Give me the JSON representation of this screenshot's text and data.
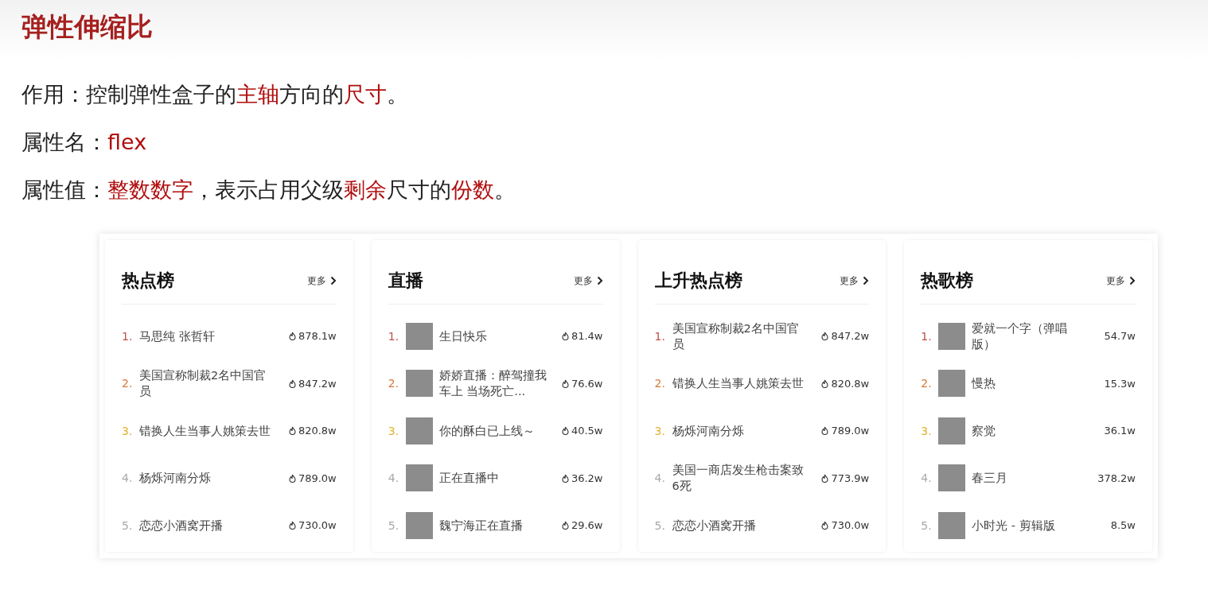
{
  "title": "弹性伸缩比",
  "lines": [
    {
      "segments": [
        {
          "text": "作用：控制弹性盒子的",
          "highlight": false
        },
        {
          "text": "主轴",
          "highlight": true
        },
        {
          "text": "方向的",
          "highlight": false
        },
        {
          "text": "尺寸",
          "highlight": true
        },
        {
          "text": "。",
          "highlight": false
        }
      ]
    },
    {
      "segments": [
        {
          "text": "属性名：",
          "highlight": false
        },
        {
          "text": "flex",
          "highlight": true
        }
      ]
    },
    {
      "segments": [
        {
          "text": "属性值：",
          "highlight": false
        },
        {
          "text": "整数数字",
          "highlight": true
        },
        {
          "text": "，表示占用父级",
          "highlight": false
        },
        {
          "text": "剩余",
          "highlight": true
        },
        {
          "text": "尺寸的",
          "highlight": false
        },
        {
          "text": "份数",
          "highlight": true
        },
        {
          "text": "。",
          "highlight": false
        }
      ]
    }
  ],
  "cards": [
    {
      "title": "热点榜",
      "more": "更多",
      "show_flame": true,
      "items": [
        {
          "rank": "1.",
          "color": "#c0504d",
          "kind": "plain",
          "text": "马思纯 张哲轩",
          "count": "878.1w"
        },
        {
          "rank": "2.",
          "color": "#d9773a",
          "kind": "plain",
          "text": "美国宣称制裁2名中国官员",
          "count": "847.2w"
        },
        {
          "rank": "3.",
          "color": "#e0b12a",
          "kind": "plain",
          "text": "错换人生当事人姚策去世",
          "count": "820.8w"
        },
        {
          "rank": "4.",
          "color": "#a8a8a8",
          "kind": "plain",
          "text": "杨烁河南分烁",
          "count": "789.0w"
        },
        {
          "rank": "5.",
          "color": "#a8a8a8",
          "kind": "plain",
          "text": "恋恋小酒窝开播",
          "count": "730.0w"
        }
      ]
    },
    {
      "title": "直播",
      "more": "更多",
      "show_flame": true,
      "items": [
        {
          "rank": "1.",
          "color": "#c0504d",
          "kind": "thumb",
          "text": "生日快乐",
          "count": "81.4w"
        },
        {
          "rank": "2.",
          "color": "#d9773a",
          "kind": "thumb",
          "text": "娇娇直播：醉驾撞我车上 当场死亡...",
          "count": "76.6w"
        },
        {
          "rank": "3.",
          "color": "#e0b12a",
          "kind": "thumb",
          "text": "你的酥白已上线～",
          "count": "40.5w"
        },
        {
          "rank": "4.",
          "color": "#a8a8a8",
          "kind": "thumb",
          "text": "正在直播中",
          "count": "36.2w"
        },
        {
          "rank": "5.",
          "color": "#a8a8a8",
          "kind": "thumb",
          "text": "魏宁海正在直播",
          "count": "29.6w"
        }
      ]
    },
    {
      "title": "上升热点榜",
      "more": "更多",
      "show_flame": true,
      "items": [
        {
          "rank": "1.",
          "color": "#c0504d",
          "kind": "plain",
          "text": "美国宣称制裁2名中国官员",
          "count": "847.2w"
        },
        {
          "rank": "2.",
          "color": "#d9773a",
          "kind": "plain",
          "text": "错换人生当事人姚策去世",
          "count": "820.8w"
        },
        {
          "rank": "3.",
          "color": "#e0b12a",
          "kind": "plain",
          "text": "杨烁河南分烁",
          "count": "789.0w"
        },
        {
          "rank": "4.",
          "color": "#a8a8a8",
          "kind": "plain",
          "text": "美国一商店发生枪击案致6死",
          "count": "773.9w"
        },
        {
          "rank": "5.",
          "color": "#a8a8a8",
          "kind": "plain",
          "text": "恋恋小酒窝开播",
          "count": "730.0w"
        }
      ]
    },
    {
      "title": "热歌榜",
      "more": "更多",
      "show_flame": false,
      "items": [
        {
          "rank": "1.",
          "color": "#c0504d",
          "kind": "thumb",
          "text": "爱就一个字（弹唱版）",
          "count": "54.7w"
        },
        {
          "rank": "2.",
          "color": "#d9773a",
          "kind": "thumb",
          "text": "慢热",
          "count": "15.3w"
        },
        {
          "rank": "3.",
          "color": "#e0b12a",
          "kind": "thumb",
          "text": "察觉",
          "count": "36.1w"
        },
        {
          "rank": "4.",
          "color": "#a8a8a8",
          "kind": "thumb",
          "text": "春三月",
          "count": "378.2w"
        },
        {
          "rank": "5.",
          "color": "#a8a8a8",
          "kind": "thumb",
          "text": "小时光 - 剪辑版",
          "count": "8.5w"
        }
      ]
    }
  ]
}
